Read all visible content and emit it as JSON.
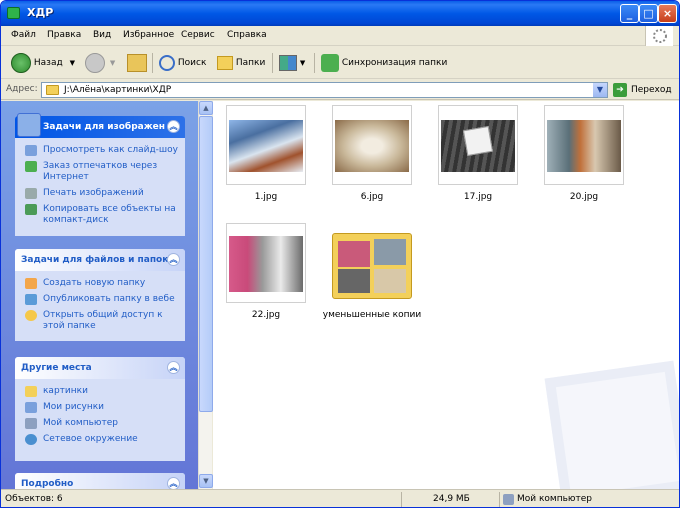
{
  "window": {
    "title": "ХДР",
    "buttons": {
      "minimize": "_",
      "maximize": "□",
      "close": "×"
    }
  },
  "menu": [
    "Файл",
    "Правка",
    "Вид",
    "Избранное",
    "Сервис",
    "Справка"
  ],
  "toolbar": {
    "back": "Назад",
    "search": "Поиск",
    "folders": "Папки",
    "sync": "Синхронизация папки"
  },
  "address": {
    "label": "Адрес:",
    "value": "J:\\Алёна\\картинки\\ХДР",
    "go": "Переход"
  },
  "tasks": {
    "image_tasks": {
      "title": "Задачи для изображен",
      "items": [
        "Просмотреть как слайд-шоу",
        "Заказ отпечатков через Интернет",
        "Печать изображений",
        "Копировать все объекты на компакт-диск"
      ]
    },
    "file_tasks": {
      "title": "Задачи для файлов и папок",
      "items": [
        "Создать новую папку",
        "Опубликовать папку в вебе",
        "Открыть общий доступ к этой папке"
      ]
    },
    "other_places": {
      "title": "Другие места",
      "items": [
        "картинки",
        "Мои рисунки",
        "Мой компьютер",
        "Сетевое окружение"
      ]
    },
    "details": {
      "title": "Подробно"
    }
  },
  "files": [
    "1.jpg",
    "6.jpg",
    "17.jpg",
    "20.jpg",
    "22.jpg",
    "уменьшенные копии"
  ],
  "status": {
    "objects": "Объектов: 6",
    "size": "24,9 МБ",
    "location": "Мой компьютер"
  }
}
